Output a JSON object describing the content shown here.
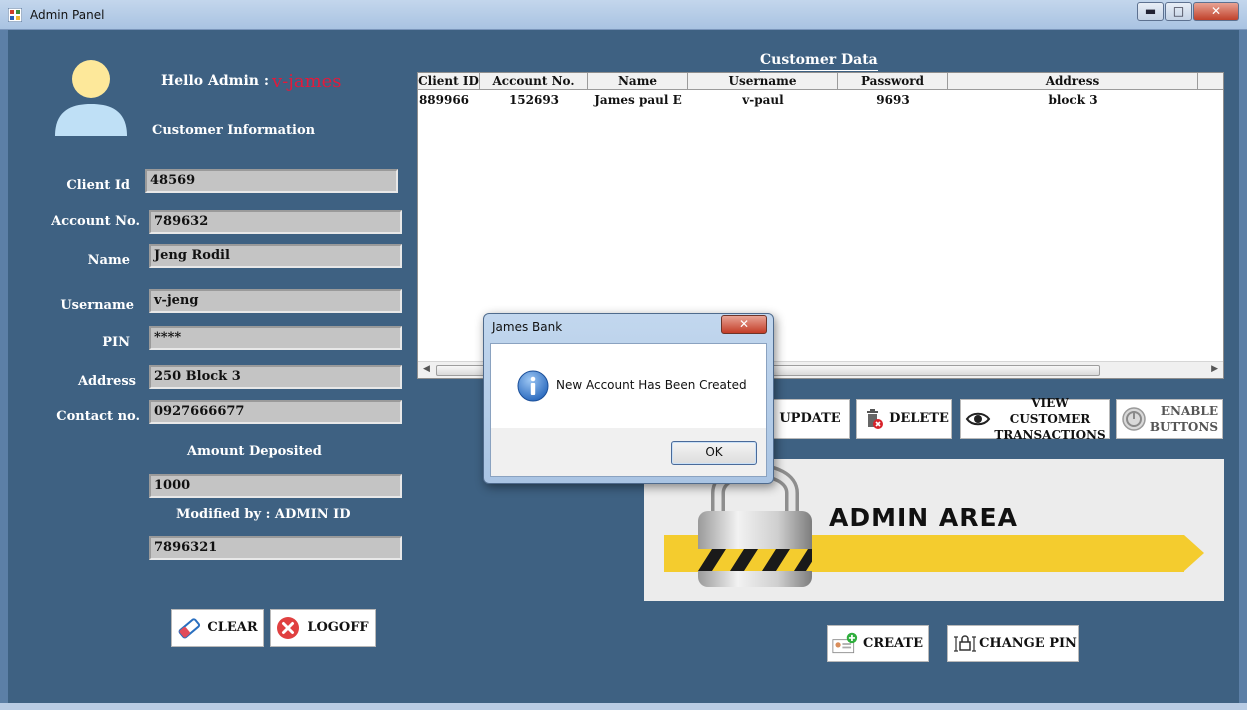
{
  "window": {
    "title": "Admin Panel",
    "controls": {
      "minimize": "▬",
      "maximize": "□",
      "close": "✕"
    }
  },
  "left": {
    "greeting_label": "Hello Admin :",
    "admin_name": "v-james",
    "section_title": "Customer Information",
    "fields": {
      "client_id": {
        "label": "Client Id",
        "value": "48569"
      },
      "account_no": {
        "label": "Account No.",
        "value": "789632"
      },
      "name": {
        "label": "Name",
        "value": "Jeng Rodil"
      },
      "username": {
        "label": "Username",
        "value": "v-jeng"
      },
      "pin": {
        "label": "PIN",
        "value": "****"
      },
      "address": {
        "label": "Address",
        "value": "250 Block 3"
      },
      "contact": {
        "label": "Contact no.",
        "value": "0927666677"
      }
    },
    "amount_label": "Amount Deposited",
    "amount_value": "1000",
    "modified_label": "Modified by : ADMIN ID",
    "modified_value": "7896321",
    "buttons": {
      "clear": "CLEAR",
      "logoff": "LOGOFF"
    }
  },
  "grid": {
    "title": "Customer Data",
    "columns": [
      "Client ID",
      "Account No.",
      "Name",
      "Username",
      "Password",
      "Address"
    ],
    "rows": [
      [
        "889966",
        "152693",
        "James paul E",
        "v-paul",
        "9693",
        "block 3"
      ]
    ]
  },
  "actions": {
    "update": "UPDATE",
    "delete": "DELETE",
    "view_line1": "VIEW CUSTOMER",
    "view_line2": "TRANSACTIONS",
    "enable_line1": "ENABLE",
    "enable_line2": "BUTTONS",
    "create": "CREATE",
    "change_pin": "CHANGE PIN"
  },
  "banner": {
    "text": "ADMIN AREA"
  },
  "dialog": {
    "title": "James Bank",
    "message": "New Account Has Been Created",
    "ok": "OK",
    "close": "✕"
  },
  "colors": {
    "panel": "#3e6182",
    "accent_red": "#e3193b",
    "banner_yellow": "#f4cc2e"
  }
}
